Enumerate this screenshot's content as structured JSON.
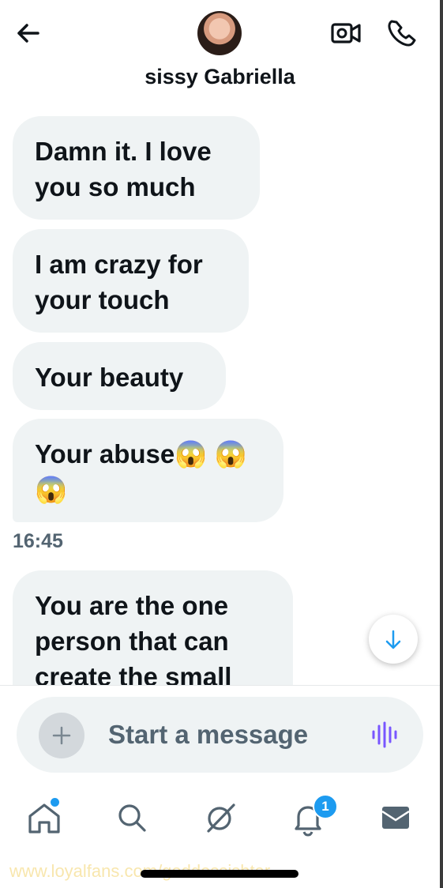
{
  "header": {
    "contact_name": "sissy Gabriella"
  },
  "messages": [
    {
      "text": "Damn it. I love you so much"
    },
    {
      "text": "I am crazy for your touch"
    },
    {
      "text": "Your beauty"
    },
    {
      "text": "Your abuse😱 😱 😱"
    },
    {
      "text": "You are the one person that can create the small"
    }
  ],
  "timestamp": "16:45",
  "composer": {
    "placeholder": "Start a message"
  },
  "nav": {
    "items": [
      {
        "icon": "home-icon",
        "active_dot": true
      },
      {
        "icon": "search-icon"
      },
      {
        "icon": "grok-icon"
      },
      {
        "icon": "bell-icon",
        "badge": "1"
      },
      {
        "icon": "mail-icon"
      }
    ]
  },
  "watermark": "www.loyalfans.com/goddessishtar",
  "colors": {
    "accent": "#1d9bf0",
    "bubble": "#eff3f4",
    "secondary_text": "#536471",
    "voice_icon": "#7856ff"
  }
}
